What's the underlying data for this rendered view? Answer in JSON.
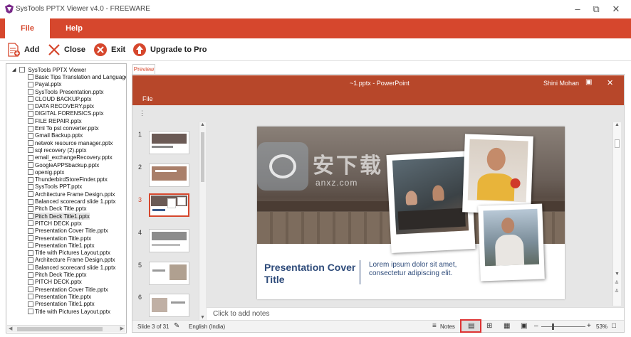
{
  "window": {
    "title": "SysTools PPTX Viewer v4.0 - FREEWARE"
  },
  "ribbon": {
    "tabs": [
      "File",
      "Help"
    ]
  },
  "toolbar": {
    "add": "Add",
    "close": "Close",
    "exit": "Exit",
    "upgrade": "Upgrade to Pro"
  },
  "tree": {
    "root": "SysTools PPTX Viewer",
    "items": [
      "Basic Tips Translation and Language Options",
      "Payal.pptx",
      "SysTools Presentation.pptx",
      "CLOUD BACKUP.pptx",
      "DATA RECOVERY.pptx",
      "DIGITAL FORENSICS.pptx",
      "FILE REPAIR.pptx",
      "Eml To pst converter.pptx",
      "Gmail Backup.pptx",
      "netwok resource manager.pptx",
      "sql recovery (2).pptx",
      "email_exchangeRecovery.pptx",
      "GoogleAPPSbackup.pptx",
      "openig.pptx",
      "ThunderbirdStoreFinder.pptx",
      "SysTools PPT.pptx",
      "Architecture Frame Design.pptx",
      "Balanced scorecard slide 1.pptx",
      "Pitch Deck Title.pptx",
      "Pitch Deck Title1.pptx",
      "PITCH DECK.pptx",
      "Presentation Cover Title.pptx",
      "Presentation Title.pptx",
      "Presentation Title1.pptx",
      "Title with Pictures Layout.pptx",
      "Architecture Frame Design.pptx",
      "Balanced scorecard slide 1.pptx",
      "Pitch Deck Title.pptx",
      "PITCH DECK.pptx",
      "Presentation Cover Title.pptx",
      "Presentation Title.pptx",
      "Presentation Title1.pptx",
      "Title with Pictures Layout.pptx"
    ]
  },
  "preview": {
    "tab_label": "Preview",
    "ppt_title": "~1.pptx - PowerPoint",
    "user": "Shini Mohan",
    "file_tab": "File",
    "thumb_numbers": [
      "1",
      "2",
      "3",
      "4",
      "5",
      "6"
    ],
    "slide": {
      "title": "Presentation Cover Title",
      "body": "Lorem ipsum dolor sit amet, consectetur adipiscing elit."
    },
    "watermark": {
      "main": "安下载",
      "sub": "anxz.com"
    },
    "notes_placeholder": "Click to add notes",
    "status": {
      "slide": "Slide 3 of 31",
      "language": "English (India)",
      "notes": "Notes",
      "zoom": "53%"
    }
  },
  "colors": {
    "accent": "#d6472d",
    "ppt_red": "#b7472a"
  }
}
